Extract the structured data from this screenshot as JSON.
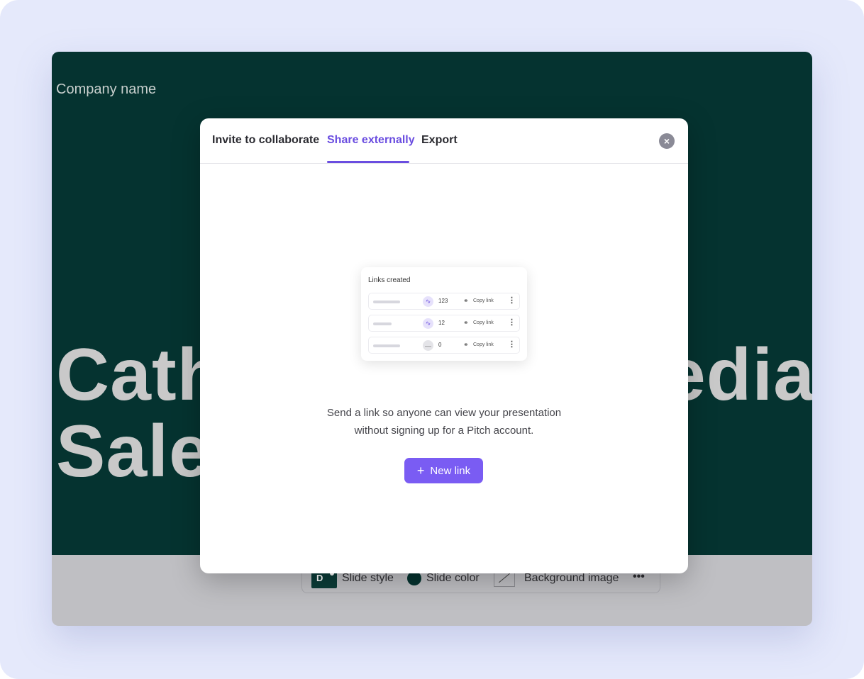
{
  "slide": {
    "company_name": "Company name",
    "headline_line1_left": "Cath",
    "headline_line1_right": "edia",
    "headline_line2_left": "Sale"
  },
  "toolbar": {
    "style_badge": "D",
    "slide_style": "Slide style",
    "slide_color": "Slide color",
    "background_image": "Background image",
    "more": "•••"
  },
  "modal": {
    "tabs": [
      {
        "label": "Invite to collaborate",
        "active": false
      },
      {
        "label": "Share externally",
        "active": true
      },
      {
        "label": "Export",
        "active": false
      }
    ],
    "close_icon": "×",
    "illustration": {
      "title": "Links created",
      "rows": [
        {
          "count": "123",
          "copy_label": "Copy link",
          "status": "active"
        },
        {
          "count": "12",
          "copy_label": "Copy link",
          "status": "active"
        },
        {
          "count": "0",
          "copy_label": "Copy link",
          "status": "inactive"
        }
      ]
    },
    "description_line1": "Send a link so anyone can view your presentation",
    "description_line2": "without signing up for a Pitch account.",
    "new_link_label": "New link",
    "new_link_icon": "+"
  },
  "colors": {
    "accent": "#6a4de0",
    "button": "#7a5cf3",
    "slide_bg": "#053330",
    "page_bg": "#e5e9fb"
  }
}
